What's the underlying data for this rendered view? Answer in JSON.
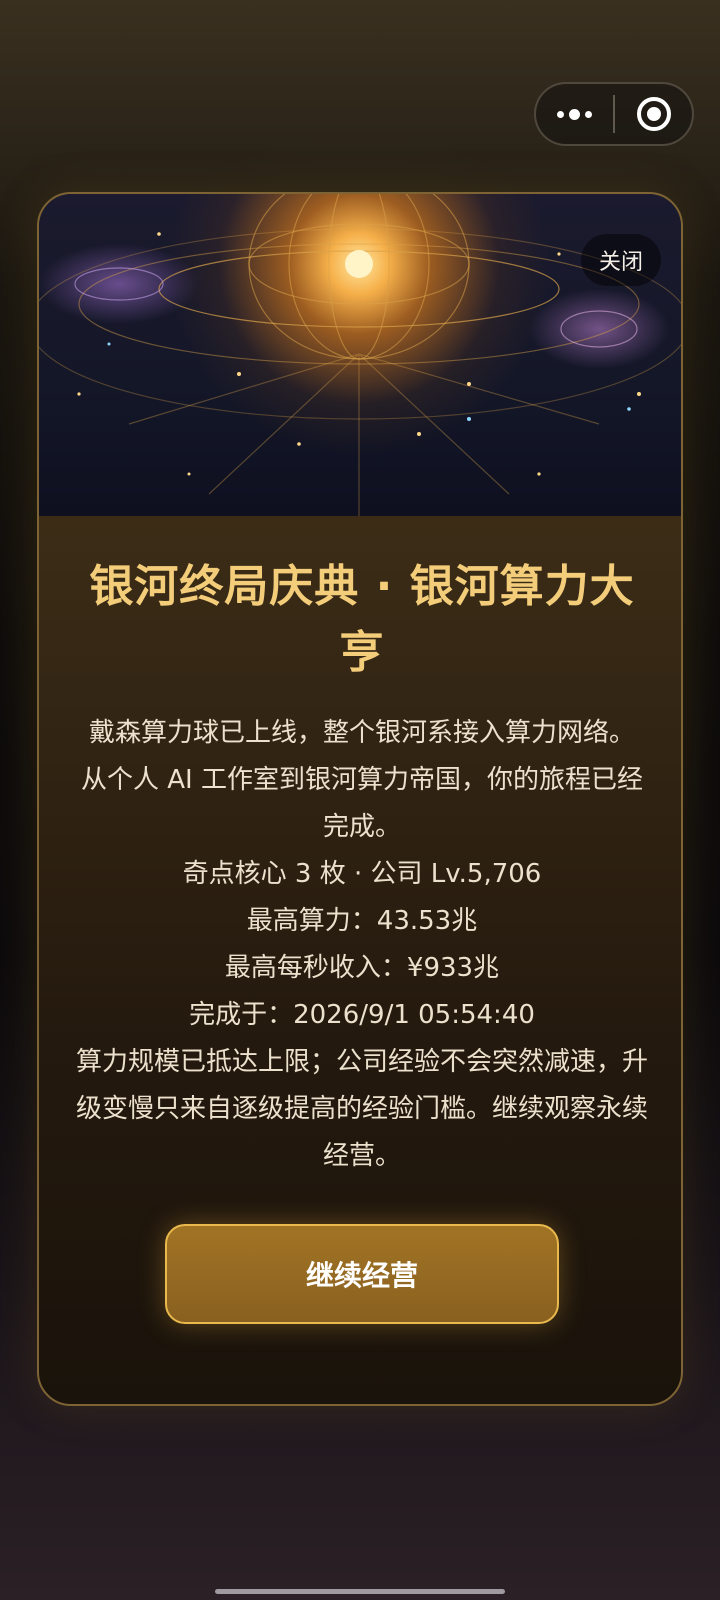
{
  "capsule": {
    "more_icon": "more-dots-icon",
    "close_icon": "target-circle-icon"
  },
  "hero": {
    "image": "galaxy-dyson-sphere-illustration",
    "close_label": "关闭"
  },
  "dialog": {
    "title": "银河终局庆典 · 银河算力大亨",
    "lines": [
      "戴森算力球已上线，整个银河系接入算力网络。",
      "从个人 AI 工作室到银河算力帝国，你的旅程已经完成。",
      "奇点核心 3 枚 · 公司 Lv.5,706",
      "最高算力：43.53兆",
      "最高每秒收入：¥933兆",
      "完成于：2026/9/1 05:54:40",
      "算力规模已抵达上限；公司经验不会突然减速，升级变慢只来自逐级提高的经验门槛。继续观察永续经营。"
    ],
    "button_label": "继续经营"
  },
  "colors": {
    "accent_gold": "#f3cd7a",
    "button_border": "#e9b94e",
    "button_fill": "#a17424",
    "card_border": "#7e6434"
  }
}
